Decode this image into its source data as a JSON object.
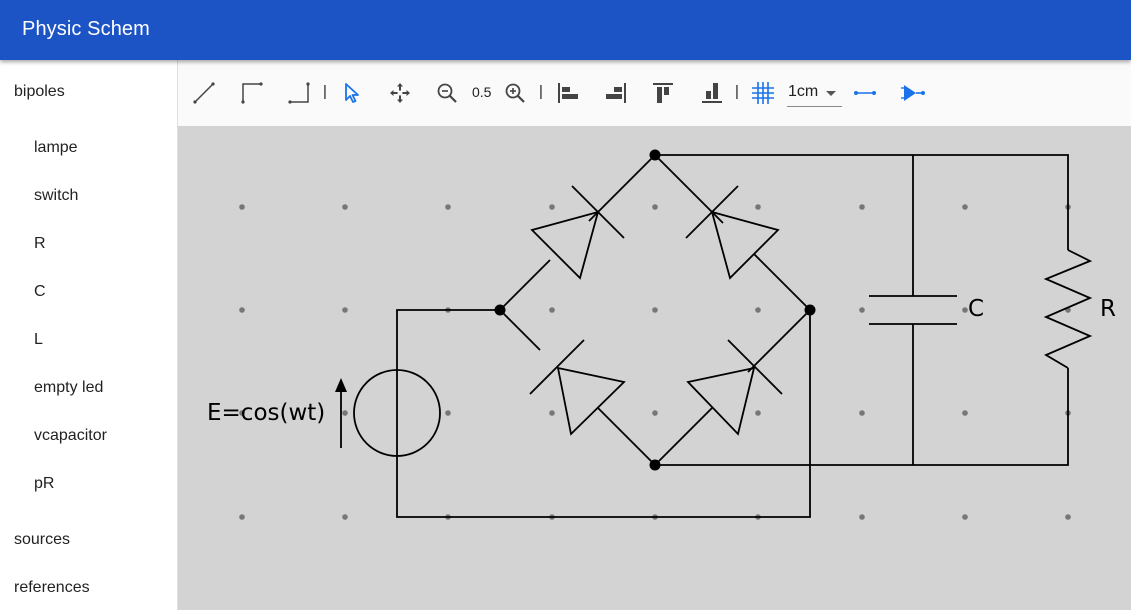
{
  "app": {
    "title": "Physic Schem"
  },
  "sidebar": {
    "categories": [
      {
        "label": "bipoles"
      },
      {
        "label": "sources"
      },
      {
        "label": "references"
      }
    ],
    "bipoles": [
      {
        "label": "lampe"
      },
      {
        "label": "switch"
      },
      {
        "label": "R"
      },
      {
        "label": "C"
      },
      {
        "label": "L"
      },
      {
        "label": "empty led"
      },
      {
        "label": "vcapacitor"
      },
      {
        "label": "pR"
      }
    ]
  },
  "toolbar": {
    "tools": [
      "wire-line-icon",
      "wire-corner-icon",
      "wire-corner-alt-icon",
      "select-pointer-icon",
      "move-icon",
      "zoom-out-icon",
      "zoom-in-icon",
      "align-left-icon",
      "align-right-icon",
      "align-top-icon",
      "align-bottom-icon",
      "grid-icon",
      "wire-mode-icon",
      "diode-mode-icon"
    ],
    "separator": "|",
    "zoom_value": "0.5",
    "grid_size": "1cm",
    "accent_color": "#1a73e8"
  },
  "schematic": {
    "source_label": "E=cos(wt)",
    "capacitor_label": "C",
    "resistor_label": "R",
    "background": "#d3d3d3"
  }
}
